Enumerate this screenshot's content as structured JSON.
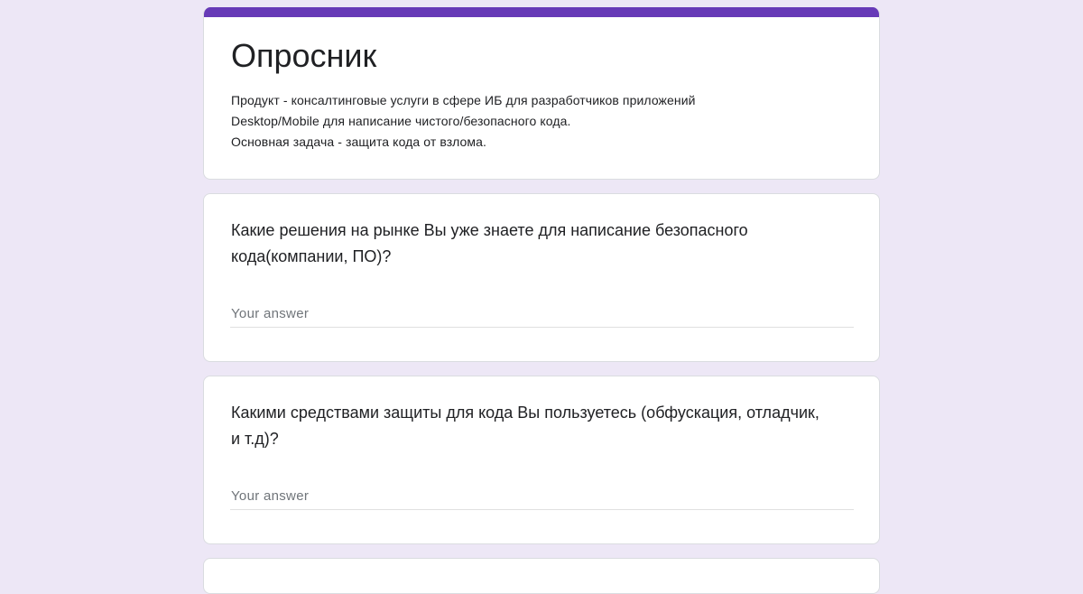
{
  "form": {
    "title": "Опросник",
    "description": "Продукт - консалтинговые услуги в сфере ИБ для разработчиков приложений\nDesktop/Mobile для написание чистого/безопасного кода.\nОсновная задача - защита кода от взлома.",
    "accent_color": "#673ab7",
    "background_color": "#ede7f6"
  },
  "questions": [
    {
      "text": "Какие решения на рынке Вы уже знаете для написание безопасного кода(компании, ПО)?",
      "placeholder": "Your answer",
      "value": ""
    },
    {
      "text": "Какими средствами защиты для кода Вы пользуетесь (обфускация, отладчик, и т.д)?",
      "placeholder": "Your answer",
      "value": ""
    }
  ]
}
